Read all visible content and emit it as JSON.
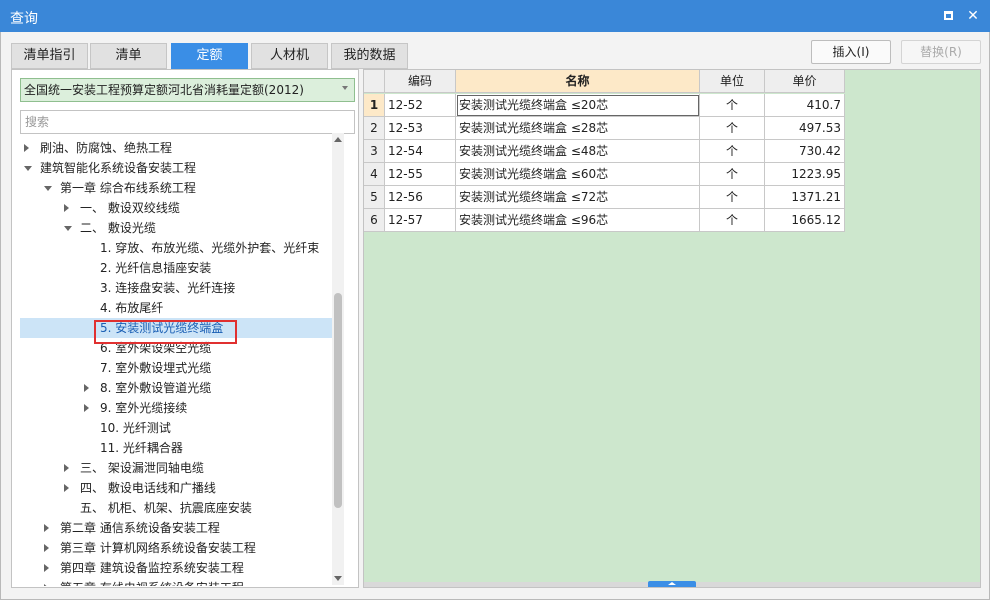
{
  "window": {
    "title": "查询"
  },
  "tabs": [
    {
      "label": "清单指引",
      "active": false
    },
    {
      "label": "清单",
      "active": false
    },
    {
      "label": "定额",
      "active": true
    },
    {
      "label": "人材机",
      "active": false
    },
    {
      "label": "我的数据",
      "active": false
    }
  ],
  "actions": {
    "insert_label": "插入(I)",
    "replace_label": "替换(R)"
  },
  "library": {
    "selected": "全国统一安装工程预算定额河北省消耗量定额(2012)"
  },
  "search": {
    "placeholder": "搜索",
    "value": ""
  },
  "tree": {
    "nodes": [
      {
        "label": "刷油、防腐蚀、绝热工程",
        "level": 0,
        "toggle": "collapsed"
      },
      {
        "label": "建筑智能化系统设备安装工程",
        "level": 0,
        "toggle": "expanded"
      },
      {
        "label": "第一章 综合布线系统工程",
        "level": 1,
        "toggle": "expanded"
      },
      {
        "label": "一、 敷设双绞线缆",
        "level": 2,
        "toggle": "collapsed"
      },
      {
        "label": "二、 敷设光缆",
        "level": 2,
        "toggle": "expanded"
      },
      {
        "label": "1. 穿放、布放光缆、光缆外护套、光纤束",
        "level": 3,
        "toggle": "none"
      },
      {
        "label": "2. 光纤信息插座安装",
        "level": 3,
        "toggle": "none"
      },
      {
        "label": "3. 连接盘安装、光纤连接",
        "level": 3,
        "toggle": "none"
      },
      {
        "label": "4. 布放尾纤",
        "level": 3,
        "toggle": "none"
      },
      {
        "label": "5. 安装测试光缆终端盒",
        "level": 3,
        "toggle": "none",
        "selected": true
      },
      {
        "label": "6. 室外架设架空光缆",
        "level": 3,
        "toggle": "none"
      },
      {
        "label": "7. 室外敷设埋式光缆",
        "level": 3,
        "toggle": "none"
      },
      {
        "label": "8. 室外敷设管道光缆",
        "level": 3,
        "toggle": "collapsed"
      },
      {
        "label": "9. 室外光缆接续",
        "level": 3,
        "toggle": "collapsed"
      },
      {
        "label": "10. 光纤测试",
        "level": 3,
        "toggle": "none"
      },
      {
        "label": "11. 光纤耦合器",
        "level": 3,
        "toggle": "none"
      },
      {
        "label": "三、 架设漏泄同轴电缆",
        "level": 2,
        "toggle": "collapsed"
      },
      {
        "label": "四、 敷设电话线和广播线",
        "level": 2,
        "toggle": "collapsed"
      },
      {
        "label": "五、 机柜、机架、抗震底座安装",
        "level": 2,
        "toggle": "none"
      },
      {
        "label": "第二章 通信系统设备安装工程",
        "level": 1,
        "toggle": "collapsed"
      },
      {
        "label": "第三章 计算机网络系统设备安装工程",
        "level": 1,
        "toggle": "collapsed"
      },
      {
        "label": "第四章 建筑设备监控系统安装工程",
        "level": 1,
        "toggle": "collapsed"
      },
      {
        "label": "第五章 有线电视系统设备安装工程",
        "level": 1,
        "toggle": "collapsed"
      }
    ]
  },
  "table": {
    "columns": [
      "编码",
      "名称",
      "单位",
      "单价"
    ],
    "rows": [
      {
        "num": "1",
        "code": "12-52",
        "name": "安装测试光缆终端盒 ≤20芯",
        "unit": "个",
        "price": "410.7"
      },
      {
        "num": "2",
        "code": "12-53",
        "name": "安装测试光缆终端盒 ≤28芯",
        "unit": "个",
        "price": "497.53"
      },
      {
        "num": "3",
        "code": "12-54",
        "name": "安装测试光缆终端盒 ≤48芯",
        "unit": "个",
        "price": "730.42"
      },
      {
        "num": "4",
        "code": "12-55",
        "name": "安装测试光缆终端盒 ≤60芯",
        "unit": "个",
        "price": "1223.95"
      },
      {
        "num": "5",
        "code": "12-56",
        "name": "安装测试光缆终端盒 ≤72芯",
        "unit": "个",
        "price": "1371.21"
      },
      {
        "num": "6",
        "code": "12-57",
        "name": "安装测试光缆终端盒 ≤96芯",
        "unit": "个",
        "price": "1665.12"
      }
    ]
  },
  "colors": {
    "accent": "#3a8ee6",
    "titlebar": "#3a87d8",
    "grid_background": "#cde7cd",
    "library_background": "#dcefdc",
    "highlight": "#e03030"
  }
}
